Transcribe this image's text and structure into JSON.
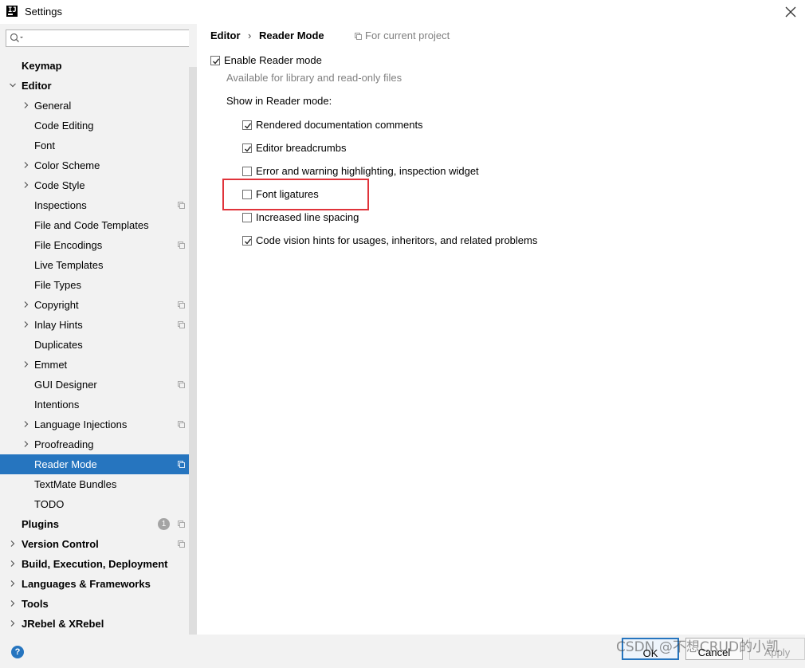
{
  "window": {
    "title": "Settings"
  },
  "search": {
    "placeholder": "",
    "value": ""
  },
  "sidebar": {
    "items": [
      {
        "label": "Keymap"
      },
      {
        "label": "Editor"
      },
      {
        "label": "General"
      },
      {
        "label": "Code Editing"
      },
      {
        "label": "Font"
      },
      {
        "label": "Color Scheme"
      },
      {
        "label": "Code Style"
      },
      {
        "label": "Inspections"
      },
      {
        "label": "File and Code Templates"
      },
      {
        "label": "File Encodings"
      },
      {
        "label": "Live Templates"
      },
      {
        "label": "File Types"
      },
      {
        "label": "Copyright"
      },
      {
        "label": "Inlay Hints"
      },
      {
        "label": "Duplicates"
      },
      {
        "label": "Emmet"
      },
      {
        "label": "GUI Designer"
      },
      {
        "label": "Intentions"
      },
      {
        "label": "Language Injections"
      },
      {
        "label": "Proofreading"
      },
      {
        "label": "Reader Mode"
      },
      {
        "label": "TextMate Bundles"
      },
      {
        "label": "TODO"
      },
      {
        "label": "Plugins",
        "badge": "1"
      },
      {
        "label": "Version Control"
      },
      {
        "label": "Build, Execution, Deployment"
      },
      {
        "label": "Languages & Frameworks"
      },
      {
        "label": "Tools"
      },
      {
        "label": "JRebel & XRebel"
      }
    ],
    "selected": "Reader Mode"
  },
  "main": {
    "breadcrumb": {
      "parent": "Editor",
      "separator": "›",
      "current": "Reader Mode"
    },
    "scope_label": "For current project",
    "enable": {
      "label": "Enable Reader mode",
      "checked": true
    },
    "hint": "Available for library and read-only files",
    "section_title": "Show in Reader mode:",
    "options": [
      {
        "label": "Rendered documentation comments",
        "checked": true
      },
      {
        "label": "Editor breadcrumbs",
        "checked": true
      },
      {
        "label": "Error and warning highlighting, inspection widget",
        "checked": false
      },
      {
        "label": "Font ligatures",
        "checked": false
      },
      {
        "label": "Increased line spacing",
        "checked": false
      },
      {
        "label": "Code vision hints for usages, inheritors, and related problems",
        "checked": true
      }
    ]
  },
  "buttons": {
    "ok": "OK",
    "cancel": "Cancel",
    "apply": "Apply",
    "help": "?"
  },
  "watermark": "CSDN @不想CRUD的小凯",
  "colors": {
    "accent": "#2675bf",
    "highlight_box": "#e0333a"
  }
}
